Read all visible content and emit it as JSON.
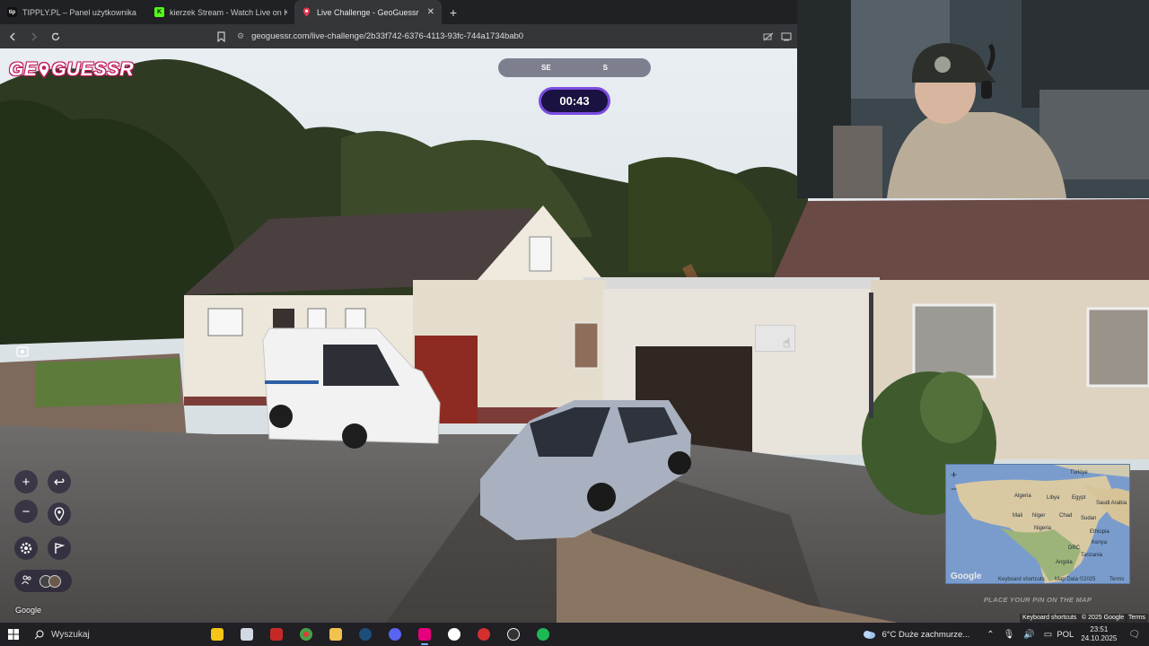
{
  "browser": {
    "tabs": [
      {
        "label": "TIPPLY.PL – Panel użytkownika",
        "favicon": "tip",
        "active": false
      },
      {
        "label": "kierzek Stream - Watch Live on Kick",
        "favicon": "K",
        "active": false
      },
      {
        "label": "Live Challenge - GeoGuessr",
        "favicon": "pin",
        "active": true
      }
    ],
    "new_tab_label": "+",
    "url": "geoguessr.com/live-challenge/2b33f742-6376-4113-93fc-744a1734bab0"
  },
  "game": {
    "logo_text_left": "GE",
    "logo_text_right": "GUESSR",
    "compass": {
      "left": "SE",
      "right": "S"
    },
    "timer": "00:43",
    "controls": {
      "zoom_in": "+",
      "zoom_out": "−",
      "undo": "↩",
      "return_pin": "⌖"
    },
    "minimap": {
      "countries": [
        {
          "name": "Türkiye"
        },
        {
          "name": "Algeria"
        },
        {
          "name": "Libya"
        },
        {
          "name": "Egypt"
        },
        {
          "name": "Saudi Arabia"
        },
        {
          "name": "Mali"
        },
        {
          "name": "Niger"
        },
        {
          "name": "Chad"
        },
        {
          "name": "Sudan"
        },
        {
          "name": "Nigeria"
        },
        {
          "name": "Ethiopia"
        },
        {
          "name": "Kenya"
        },
        {
          "name": "DRC"
        },
        {
          "name": "Tanzania"
        },
        {
          "name": "Angola"
        }
      ],
      "zoom_in": "+",
      "zoom_out": "−",
      "google_logo": "Google",
      "keyboard_shortcuts": "Keyboard shortcuts",
      "map_data": "Map Data ©2025",
      "terms": "Terms"
    },
    "place_pin_text": "PLACE YOUR PIN ON THE MAP",
    "sv_google": "Google",
    "sv_footer": {
      "keyboard_shortcuts": "Keyboard shortcuts",
      "copyright": "© 2025 Google",
      "terms": "Terms"
    }
  },
  "taskbar": {
    "search_placeholder": "Wyszukaj",
    "weather": "6°C  Duże zachmurze...",
    "language": "POL",
    "time": "23:51",
    "date": "24.10.2025"
  },
  "colors": {
    "timer_border": "#7b4ce0",
    "logo_accent": "#c2185b",
    "taskbar_bg": "#1f1f24"
  }
}
